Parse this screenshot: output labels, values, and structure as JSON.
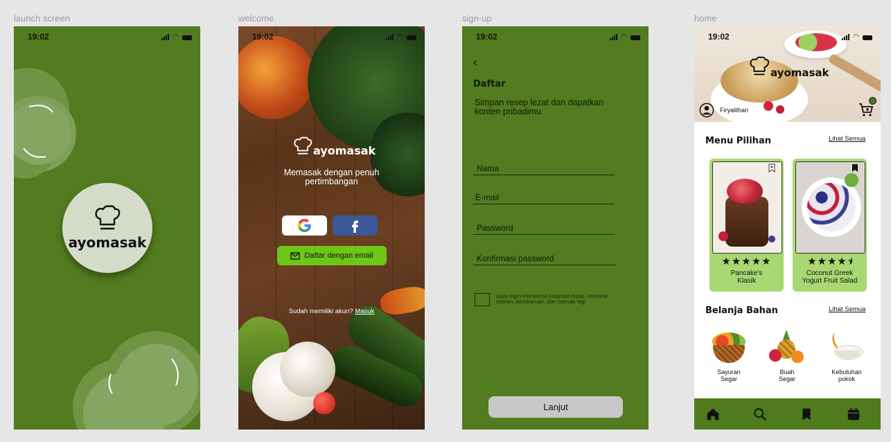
{
  "frames": {
    "launch": "launch screen",
    "welcome": "welcome",
    "signup": "sign-up",
    "home": "home"
  },
  "status_time": "19:02",
  "brand": "ayomasak",
  "launch": {
    "logo_text": "ayomasak"
  },
  "welcome": {
    "brand": "ayomasak",
    "tagline_line1": "Memasak dengan penuh",
    "tagline_line2": "pertimbangan",
    "google_icon": "google-icon",
    "facebook_icon": "facebook-icon",
    "email_button": "Daftar dengan email",
    "have_account": "Sudah memiliki akun?",
    "login_link": "Masuk"
  },
  "signup": {
    "title": "Daftar",
    "subtitle_line1": "Simpan resep lezat dan dapatkan",
    "subtitle_line2": "konten pribadimu",
    "fields": [
      "Nama",
      "E-mail",
      "Password",
      "Konfirmasi password"
    ],
    "checkbox_line1": "saya ingin menerima inspirasi resep, rencana",
    "checkbox_line2": "makan, pembaruan, dan banyak lagi",
    "next_button": "Lanjut"
  },
  "home": {
    "brand": "ayomasak",
    "username": "Firyalilhan",
    "section1_title": "Menu Pilihan",
    "see_all": "Lihat Semua",
    "cards": [
      {
        "name_line1": "Pancake's",
        "name_line2": "Klasik",
        "stars": "★★★★★",
        "rating": 5
      },
      {
        "name_line1": "Coconut Greek",
        "name_line2": "Yogurt Fruit Salad",
        "stars": "★★★★",
        "rating": 4.5
      }
    ],
    "section2_title": "Belanja Bahan",
    "categories": [
      {
        "line1": "Sayuran",
        "line2": "Segar"
      },
      {
        "line1": "Buah",
        "line2": "Segar"
      },
      {
        "line1": "Kebutuhan",
        "line2": "pokok"
      }
    ],
    "nav_icons": [
      "home-icon",
      "search-icon",
      "bookmark-icon",
      "calendar-icon"
    ]
  },
  "colors": {
    "primary_green": "#527c1f",
    "card_green": "#a8d873",
    "button_green": "#6ec619",
    "launch_circle": "#d4dcc9"
  }
}
